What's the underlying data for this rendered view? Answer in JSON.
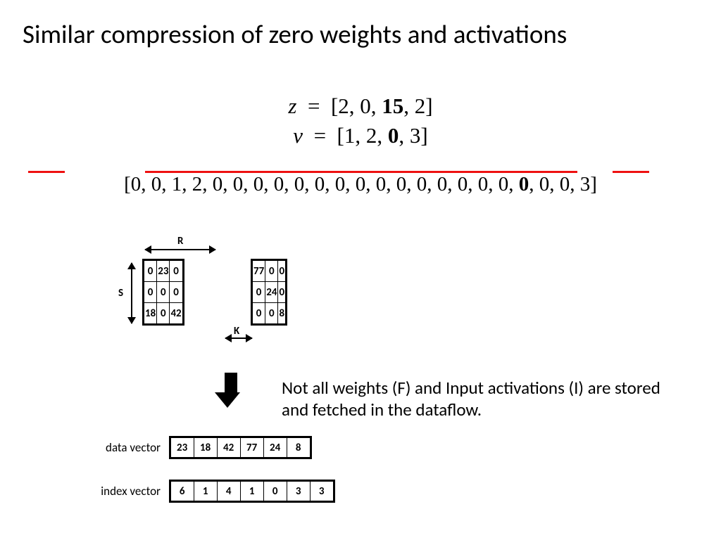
{
  "title": "Similar compression of zero weights and activations",
  "eqn": {
    "z_var": "z",
    "z_vals": "[2, 0, <b>15</b>, 2]",
    "v_var": "v",
    "v_vals": "[1, 2, <b>0</b>, 3]"
  },
  "long_vector": "[0, 0, 1, 2, 0, 0, 0, 0, 0, 0, 0, 0, 0, 0, 0, 0, 0, 0, 0, <b>0</b>, 0, 0, 3]",
  "labels": {
    "R": "R",
    "S": "S",
    "K": "K"
  },
  "matrix_left": [
    [
      "0",
      "23",
      "0"
    ],
    [
      "0",
      "0",
      "0"
    ],
    [
      "18",
      "0",
      "42"
    ]
  ],
  "matrix_right": [
    [
      "77",
      "0",
      "0"
    ],
    [
      "0",
      "24",
      "0"
    ],
    [
      "0",
      "0",
      "8"
    ]
  ],
  "body_text": "Not all weights (F) and Input activations (I) are stored and fetched in the dataflow.",
  "data_vector_label": "data vector",
  "index_vector_label": "index vector",
  "data_vector": [
    "23",
    "18",
    "42",
    "77",
    "24",
    "8"
  ],
  "index_vector": [
    "6",
    "1",
    "4",
    "1",
    "0",
    "3",
    "3"
  ],
  "chart_data": {
    "type": "table",
    "title": "Compression of zero weights/activations — example",
    "z": [
      2,
      0,
      15,
      2
    ],
    "v": [
      1,
      2,
      0,
      3
    ],
    "expanded": [
      0,
      0,
      1,
      2,
      0,
      0,
      0,
      0,
      0,
      0,
      0,
      0,
      0,
      0,
      0,
      0,
      0,
      0,
      0,
      0,
      0,
      0,
      3
    ],
    "matrices": {
      "left_SxR": [
        [
          0,
          23,
          0
        ],
        [
          0,
          0,
          0
        ],
        [
          18,
          0,
          42
        ]
      ],
      "right_SxR": [
        [
          77,
          0,
          0
        ],
        [
          0,
          24,
          0
        ],
        [
          0,
          0,
          8
        ]
      ]
    },
    "data_vector": [
      23,
      18,
      42,
      77,
      24,
      8
    ],
    "index_vector": [
      6,
      1,
      4,
      1,
      0,
      3,
      3
    ]
  }
}
